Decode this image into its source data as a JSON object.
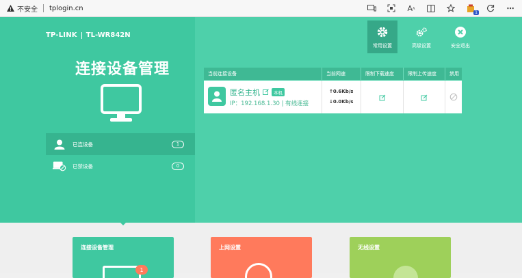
{
  "browser": {
    "security_label": "不安全",
    "url": "tplogin.cn",
    "extension_badge": "1"
  },
  "brand": {
    "logo": "TP-LINK",
    "model": "TL-WR842N"
  },
  "page_title": "连接设备管理",
  "nav": [
    {
      "label": "已连设备",
      "count": "1"
    },
    {
      "label": "已禁设备",
      "count": "0"
    }
  ],
  "top_buttons": [
    {
      "label": "常用设置",
      "icon": "gear-icon"
    },
    {
      "label": "高级设置",
      "icon": "gears-icon"
    },
    {
      "label": "安全退出",
      "icon": "close-circle-icon"
    }
  ],
  "table": {
    "headers": [
      "当前连接设备",
      "当前网速",
      "限制下载速度",
      "限制上传速度",
      "禁用"
    ],
    "rows": [
      {
        "name": "匿名主机",
        "tag": "本机",
        "info": "IP：192.168.1.30 | 有线连接",
        "up": "↑0.6Kb/s",
        "down": "↓0.0Kb/s"
      }
    ]
  },
  "cards": [
    {
      "title": "连接设备管理",
      "badge": "1"
    },
    {
      "title": "上网设置"
    },
    {
      "title": "无线设置"
    }
  ],
  "colors": {
    "teal": "#3fc8a0",
    "orange": "#ff7a5c",
    "green": "#9ed05a"
  }
}
